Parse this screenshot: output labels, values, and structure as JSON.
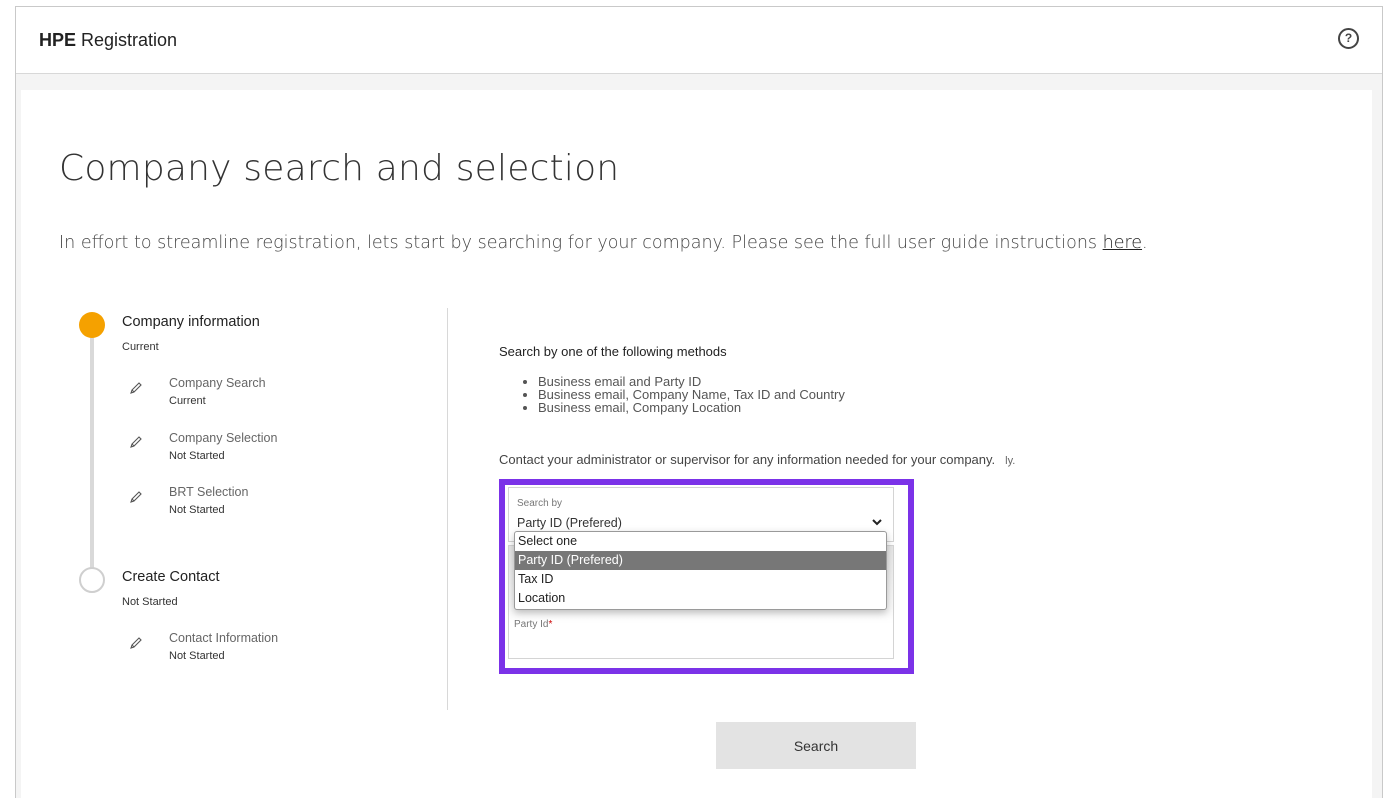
{
  "header": {
    "brand_bold": "HPE",
    "brand_rest": " Registration",
    "help_glyph": "?"
  },
  "page": {
    "title": "Company search and selection",
    "intro_text": "In effort to streamline registration, lets start by searching for your company. Please see the full user guide instructions ",
    "intro_link": "here",
    "intro_end": "."
  },
  "stepper": {
    "steps": [
      {
        "title": "Company information",
        "status": "Current",
        "substeps": [
          {
            "label": "Company Search",
            "status": "Current"
          },
          {
            "label": "Company Selection",
            "status": "Not Started"
          },
          {
            "label": "BRT Selection",
            "status": "Not Started"
          }
        ]
      },
      {
        "title": "Create Contact",
        "status": "Not Started",
        "substeps": [
          {
            "label": "Contact Information",
            "status": "Not Started"
          }
        ]
      }
    ]
  },
  "search": {
    "methods_title": "Search by one of the following methods",
    "methods": [
      "Business email and Party ID",
      "Business email, Company Name, Tax ID and Country",
      "Business email, Company Location"
    ],
    "contact_note": "Contact your administrator or supervisor for any information needed for your company.",
    "contact_trail": "ly.",
    "select_label": "Search by",
    "select_value": "Party ID (Prefered)",
    "options": [
      "Select one",
      "Party ID (Prefered)",
      "Tax ID",
      "Location"
    ],
    "selected_option": "Party ID (Prefered)",
    "party_id_label": "Party Id",
    "required_mark": "*",
    "button_label": "Search"
  },
  "colors": {
    "current_step": "#f5a100",
    "highlight": "#7b32e8",
    "selected_option_bg": "#777777"
  }
}
